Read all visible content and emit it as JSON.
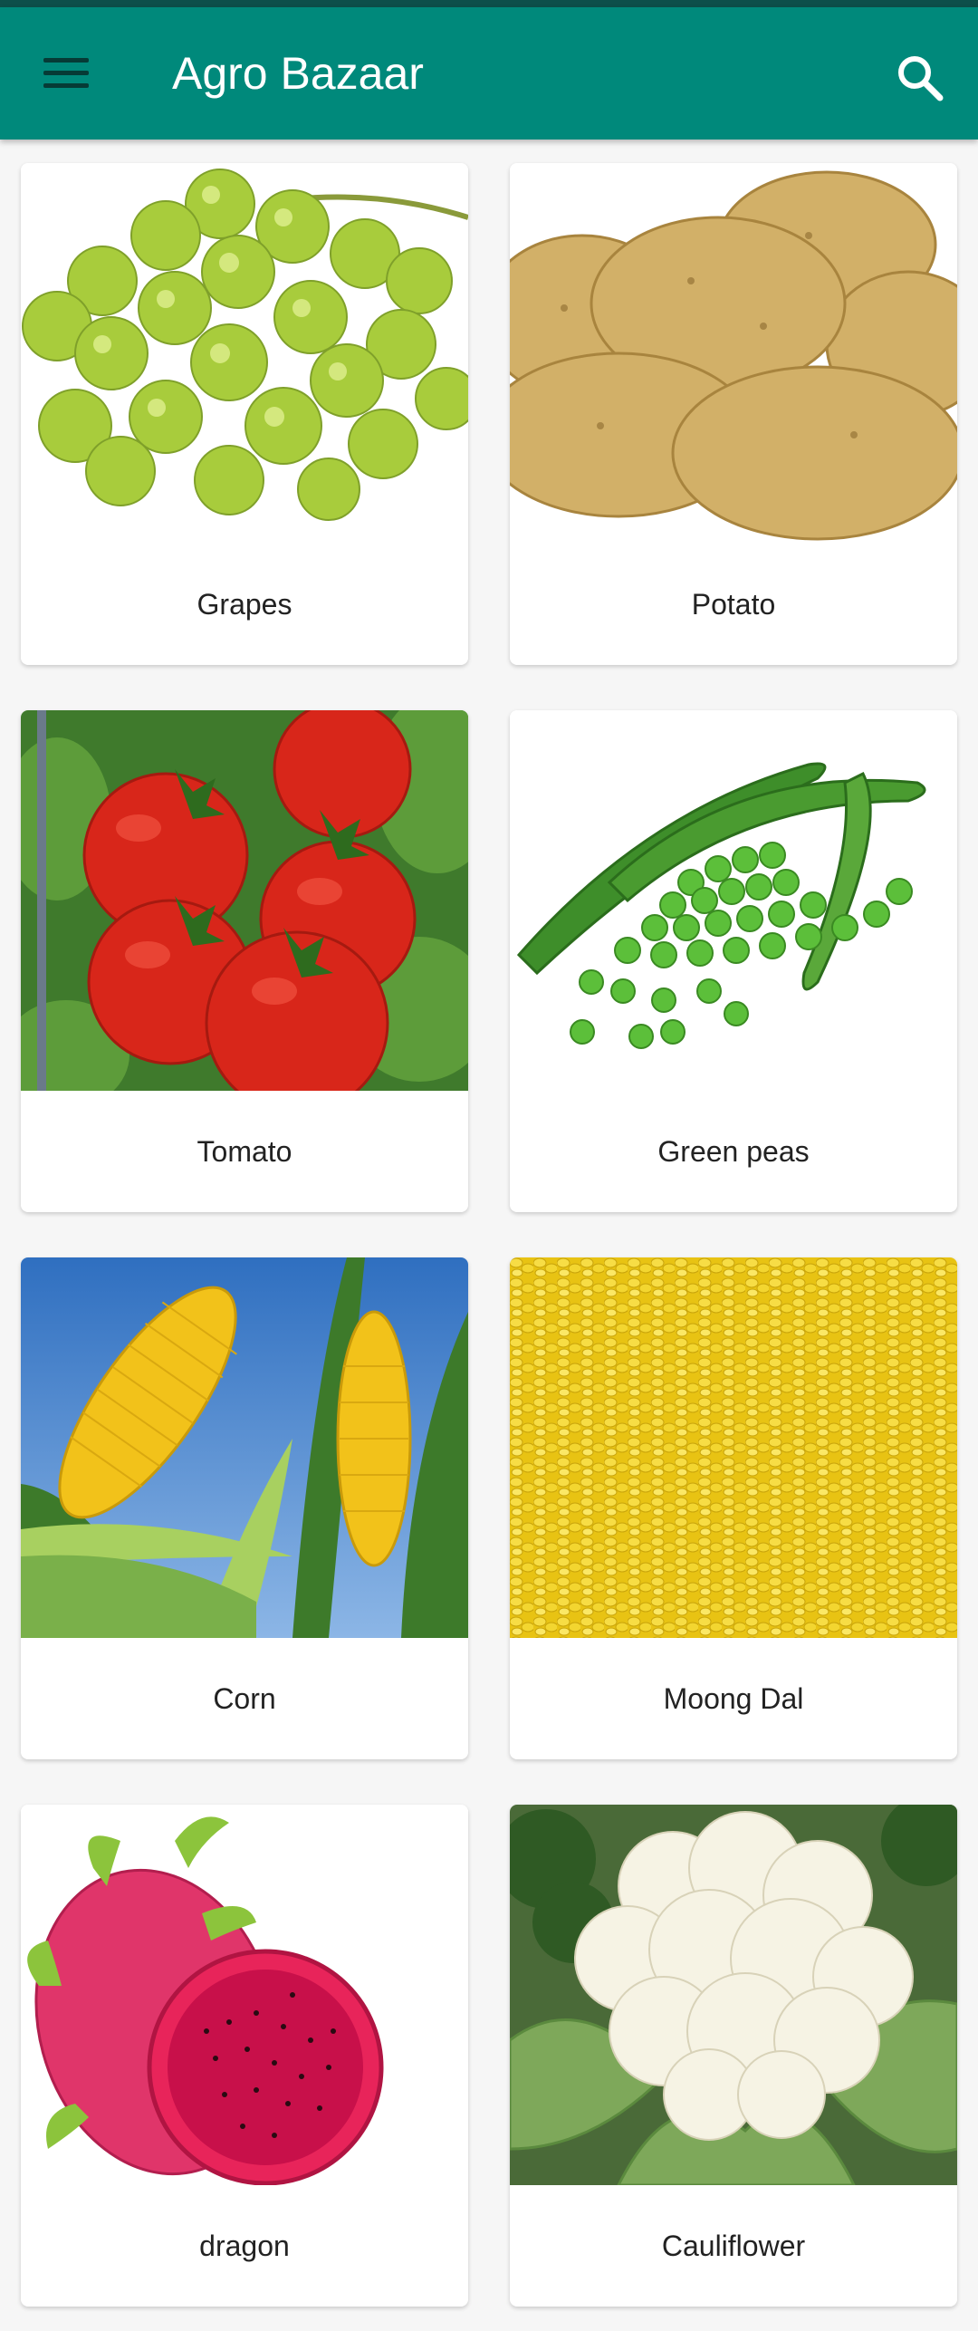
{
  "app": {
    "title": "Agro Bazaar",
    "colors": {
      "appbar": "#00897b",
      "status_line": "#0d4f4a",
      "background": "#f6f6f6"
    },
    "icons": {
      "menu": "menu-icon",
      "search": "search-icon"
    }
  },
  "products": [
    {
      "name": "Grapes"
    },
    {
      "name": "Potato"
    },
    {
      "name": "Tomato"
    },
    {
      "name": "Green peas"
    },
    {
      "name": "Corn"
    },
    {
      "name": "Moong Dal"
    },
    {
      "name": "dragon"
    },
    {
      "name": "Cauliflower"
    }
  ]
}
